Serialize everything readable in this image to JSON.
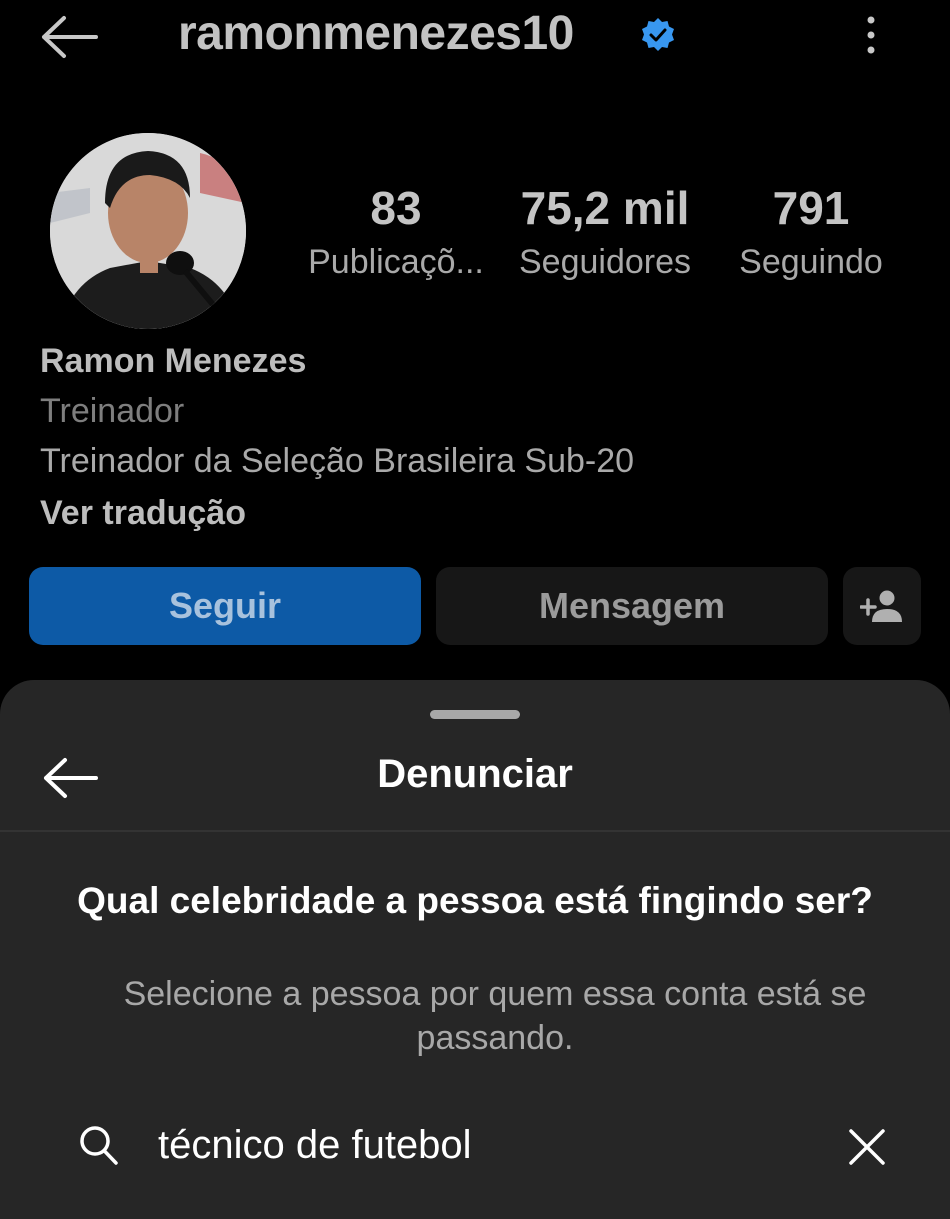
{
  "header": {
    "username": "ramonmenezes10"
  },
  "profile": {
    "stats": [
      {
        "value": "83",
        "label": "Publicaçõ..."
      },
      {
        "value": "75,2 mil",
        "label": "Seguidores"
      },
      {
        "value": "791",
        "label": "Seguindo"
      }
    ],
    "name": "Ramon Menezes",
    "category": "Treinador",
    "bio": "Treinador da Seleção Brasileira Sub-20",
    "translate_link": "Ver tradução"
  },
  "actions": {
    "follow_label": "Seguir",
    "message_label": "Mensagem"
  },
  "report_sheet": {
    "title": "Denunciar",
    "question": "Qual celebridade a pessoa está fingindo ser?",
    "subtitle": "Selecione a pessoa por quem essa conta está se passando.",
    "search_value": "técnico de futebol"
  },
  "icons": {
    "back": "arrow-left-icon",
    "verified": "verified-badge-icon",
    "more": "more-vertical-icon",
    "add_person": "add-person-icon",
    "search": "search-icon",
    "clear": "close-icon"
  },
  "colors": {
    "accent_blue": "#0d5aa6",
    "verified_blue": "#3897f0",
    "sheet_bg": "#262626"
  }
}
